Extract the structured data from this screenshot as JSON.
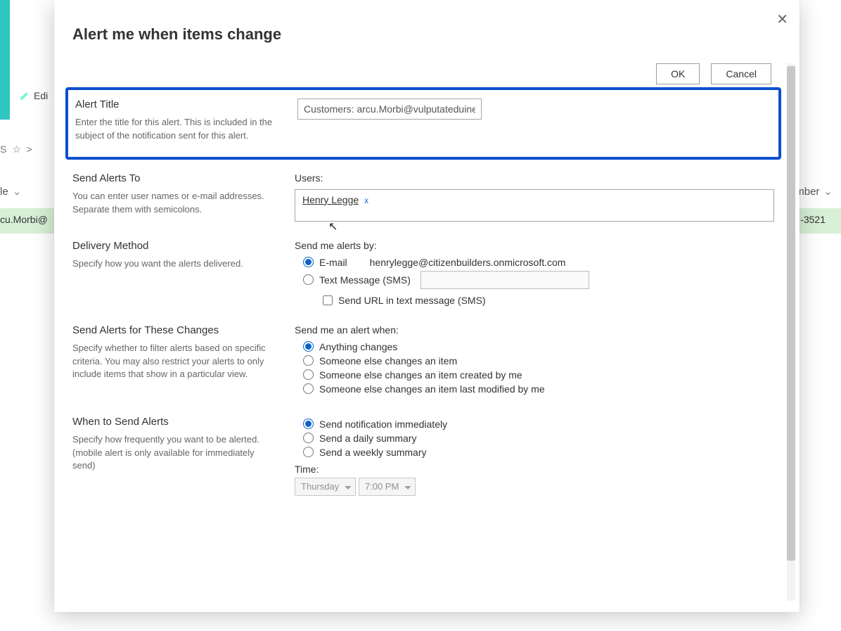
{
  "bg": {
    "edit_label": "Edi",
    "star_row": "S  ☆  >",
    "col_le": "le",
    "col_num": "umber",
    "row_left": "cu.Morbi@",
    "row_right": "-3521"
  },
  "modal": {
    "title": "Alert me when items change",
    "buttons": {
      "ok": "OK",
      "cancel": "Cancel"
    }
  },
  "sections": {
    "alertTitle": {
      "title": "Alert Title",
      "desc": "Enter the title for this alert. This is included in the subject of the notification sent for this alert.",
      "value": "Customers: arcu.Morbi@vulputateduinec."
    },
    "sendTo": {
      "title": "Send Alerts To",
      "desc": "You can enter user names or e-mail addresses. Separate them with semicolons.",
      "label": "Users:",
      "chip": "Henry Legge",
      "chip_x": "x"
    },
    "delivery": {
      "title": "Delivery Method",
      "desc": "Specify how you want the alerts delivered.",
      "label": "Send me alerts by:",
      "email_label": "E-mail",
      "email_value": "henrylegge@citizenbuilders.onmicrosoft.com",
      "sms_label": "Text Message (SMS)",
      "sms_cb": "Send URL in text message (SMS)"
    },
    "changes": {
      "title": "Send Alerts for These Changes",
      "desc": "Specify whether to filter alerts based on specific criteria. You may also restrict your alerts to only include items that show in a particular view.",
      "label": "Send me an alert when:",
      "opts": [
        "Anything changes",
        "Someone else changes an item",
        "Someone else changes an item created by me",
        "Someone else changes an item last modified by me"
      ]
    },
    "when": {
      "title": "When to Send Alerts",
      "desc": "Specify how frequently you want to be alerted. (mobile alert is only available for immediately send)",
      "opts": [
        "Send notification immediately",
        "Send a daily summary",
        "Send a weekly summary"
      ],
      "time_label": "Time:",
      "day": "Thursday",
      "hour": "7:00 PM"
    }
  }
}
